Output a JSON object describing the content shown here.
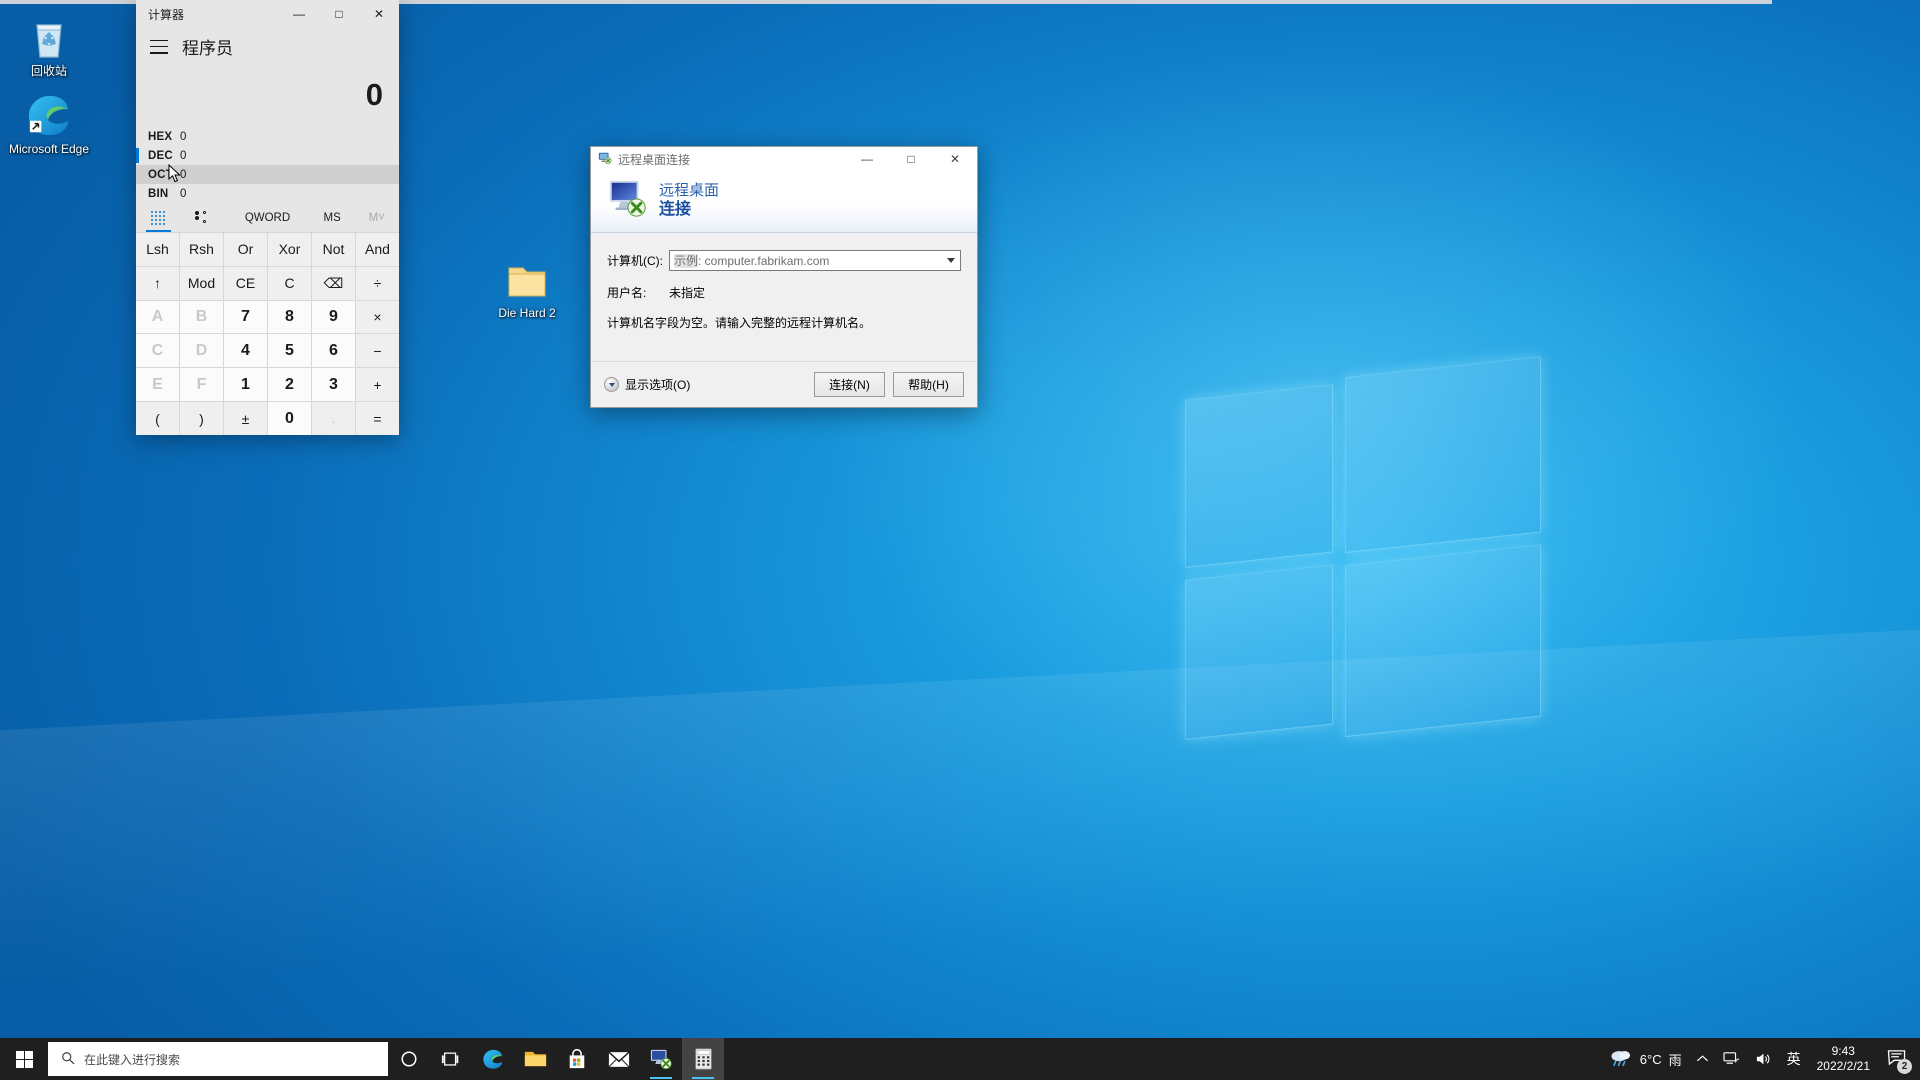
{
  "desktop": {
    "icons": [
      {
        "name": "recycle-bin",
        "label": "回收站"
      },
      {
        "name": "microsoft-edge",
        "label": "Microsoft Edge"
      },
      {
        "name": "die-hard-2-folder",
        "label": "Die Hard 2"
      }
    ]
  },
  "calculator": {
    "window_title": "计算器",
    "mode": "程序员",
    "display_value": "0",
    "radix_rows": [
      {
        "name": "HEX",
        "value": "0"
      },
      {
        "name": "DEC",
        "value": "0"
      },
      {
        "name": "OCT",
        "value": "0"
      },
      {
        "name": "BIN",
        "value": "0"
      }
    ],
    "toolbar": {
      "keypad_icon": "keypad-icon",
      "bits_icon": "bit-toggle-icon",
      "word_size": "QWORD",
      "memory_store": "MS",
      "memory_menu": "M˅"
    },
    "keys": [
      {
        "label": "Lsh",
        "kind": "op",
        "name": "left-shift"
      },
      {
        "label": "Rsh",
        "kind": "op",
        "name": "right-shift"
      },
      {
        "label": "Or",
        "kind": "op",
        "name": "bitwise-or"
      },
      {
        "label": "Xor",
        "kind": "op",
        "name": "bitwise-xor"
      },
      {
        "label": "Not",
        "kind": "op",
        "name": "bitwise-not"
      },
      {
        "label": "And",
        "kind": "op",
        "name": "bitwise-and"
      },
      {
        "label": "↑",
        "kind": "op",
        "name": "shift-up"
      },
      {
        "label": "Mod",
        "kind": "op",
        "name": "modulo"
      },
      {
        "label": "CE",
        "kind": "op",
        "name": "clear-entry"
      },
      {
        "label": "C",
        "kind": "op",
        "name": "clear"
      },
      {
        "label": "⌫",
        "kind": "op",
        "name": "backspace"
      },
      {
        "label": "÷",
        "kind": "op",
        "name": "divide"
      },
      {
        "label": "A",
        "kind": "dimnum",
        "name": "hex-a"
      },
      {
        "label": "B",
        "kind": "dimnum",
        "name": "hex-b"
      },
      {
        "label": "7",
        "kind": "num",
        "name": "digit-7"
      },
      {
        "label": "8",
        "kind": "num",
        "name": "digit-8"
      },
      {
        "label": "9",
        "kind": "num",
        "name": "digit-9"
      },
      {
        "label": "×",
        "kind": "op",
        "name": "multiply"
      },
      {
        "label": "C",
        "kind": "dimnum",
        "name": "hex-c"
      },
      {
        "label": "D",
        "kind": "dimnum",
        "name": "hex-d"
      },
      {
        "label": "4",
        "kind": "num",
        "name": "digit-4"
      },
      {
        "label": "5",
        "kind": "num",
        "name": "digit-5"
      },
      {
        "label": "6",
        "kind": "num",
        "name": "digit-6"
      },
      {
        "label": "−",
        "kind": "op",
        "name": "subtract"
      },
      {
        "label": "E",
        "kind": "dimnum",
        "name": "hex-e"
      },
      {
        "label": "F",
        "kind": "dimnum",
        "name": "hex-f"
      },
      {
        "label": "1",
        "kind": "num",
        "name": "digit-1"
      },
      {
        "label": "2",
        "kind": "num",
        "name": "digit-2"
      },
      {
        "label": "3",
        "kind": "num",
        "name": "digit-3"
      },
      {
        "label": "+",
        "kind": "op",
        "name": "add"
      },
      {
        "label": "(",
        "kind": "op",
        "name": "paren-open"
      },
      {
        "label": ")",
        "kind": "op",
        "name": "paren-close"
      },
      {
        "label": "±",
        "kind": "op",
        "name": "plus-minus"
      },
      {
        "label": "0",
        "kind": "num",
        "name": "digit-0"
      },
      {
        "label": ".",
        "kind": "dim",
        "name": "decimal-point"
      },
      {
        "label": "=",
        "kind": "op",
        "name": "equals"
      }
    ],
    "window_controls": {
      "minimize": "—",
      "maximize": "□",
      "close": "✕"
    }
  },
  "rdp_dialog": {
    "window_title": "远程桌面连接",
    "banner_line1": "远程桌面",
    "banner_line2": "连接",
    "computer_label": "计算机(C):",
    "computer_placeholder": "示例: computer.fabrikam.com",
    "computer_placeholder_prefix": "示例",
    "computer_placeholder_rest": ": computer.fabrikam.com",
    "username_label": "用户名:",
    "username_value": "未指定",
    "note": "计算机名字段为空。请输入完整的远程计算机名。",
    "show_options": "显示选项(O)",
    "connect_button": "连接(N)",
    "help_button": "帮助(H)",
    "window_controls": {
      "minimize": "—",
      "maximize": "□",
      "close": "✕"
    }
  },
  "taskbar": {
    "search_placeholder": "在此键入进行搜索",
    "icons": [
      {
        "name": "cortana-icon",
        "label": "Cortana"
      },
      {
        "name": "task-view-icon",
        "label": "任务视图"
      },
      {
        "name": "microsoft-edge-icon",
        "label": "Microsoft Edge"
      },
      {
        "name": "file-explorer-icon",
        "label": "文件资源管理器"
      },
      {
        "name": "microsoft-store-icon",
        "label": "Microsoft Store"
      },
      {
        "name": "mail-icon",
        "label": "邮件"
      },
      {
        "name": "remote-desktop-icon",
        "label": "远程桌面连接"
      },
      {
        "name": "calculator-icon",
        "label": "计算器"
      }
    ],
    "tray": {
      "weather_temp": "6°C",
      "weather_desc": "雨",
      "chevron": "︿",
      "ime_language": "英",
      "clock_time": "9:43",
      "clock_date": "2022/2/21",
      "notification_count": "2"
    }
  },
  "colors": {
    "accent": "#0078d7",
    "taskbar": "#1f1f1f",
    "calc_bg": "#e6e6e6",
    "rdp_title_blue": "#1c4e9e",
    "running_underline": "#4cc2f1"
  }
}
